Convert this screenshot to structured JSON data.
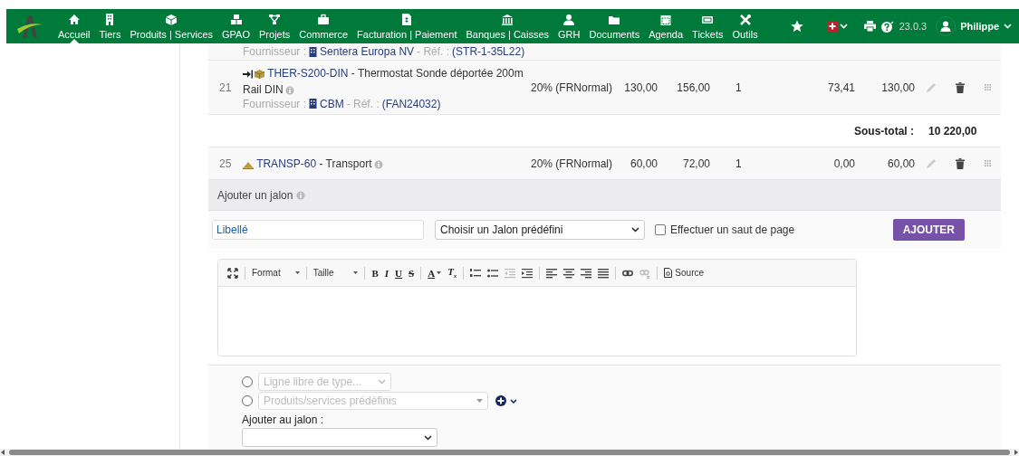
{
  "nav": {
    "items": [
      {
        "label": "Accueil",
        "selected": true
      },
      {
        "label": "Tiers",
        "selected": false
      },
      {
        "label": "Produits | Services",
        "selected": false
      },
      {
        "label": "GPAO",
        "selected": false
      },
      {
        "label": "Projets",
        "selected": false
      },
      {
        "label": "Commerce",
        "selected": false
      },
      {
        "label": "Facturation | Paiement",
        "selected": false
      },
      {
        "label": "Banques | Caisses",
        "selected": false
      },
      {
        "label": "GRH",
        "selected": false
      },
      {
        "label": "Documents",
        "selected": false
      },
      {
        "label": "Agenda",
        "selected": false
      },
      {
        "label": "Tickets",
        "selected": false
      },
      {
        "label": "Outils",
        "selected": false
      }
    ],
    "version": "23.0.3",
    "user": "Philippe"
  },
  "lines": [
    {
      "kind": "supplier_only",
      "supplier_label": "Fournisseur :",
      "supplier": "Sentera Europa NV",
      "ref_label": "- Réf. :",
      "ref": "(STR-1-35L22)"
    },
    {
      "kind": "product",
      "num": "21",
      "code": "THER-S200-DIN",
      "label": "- Thermostat Sonde déportée 200m Rail DIN",
      "vat": "20% (FRNormal)",
      "pu_ht": "130,00",
      "pu_ttc": "156,00",
      "qty": "1",
      "discount": "73,41",
      "total": "130,00",
      "supplier_label": "Fournisseur :",
      "supplier": "CBM",
      "ref_label": "- Réf. :",
      "ref": "(FAN24032)"
    },
    {
      "kind": "subtotal",
      "label": "Sous-total :",
      "total": "10 220,00"
    },
    {
      "kind": "service",
      "num": "25",
      "code": "TRANSP-60",
      "label": "- Transport",
      "vat": "20% (FRNormal)",
      "pu_ht": "60,00",
      "pu_ttc": "72,00",
      "qty": "1",
      "discount": "0,00",
      "total": "60,00"
    }
  ],
  "jalon": {
    "title": "Ajouter un jalon",
    "label_field": {
      "placeholder": "Libellé"
    },
    "predefined": "Choisir un Jalon prédéfini",
    "page_break": {
      "label": "Effectuer un saut de page",
      "checked": false
    },
    "button": "AJOUTER"
  },
  "editor": {
    "format": "Format",
    "size": "Taille",
    "bold": "B",
    "italic": "I",
    "underline": "U",
    "strike": "S",
    "text_color": "A",
    "clear_format": "T",
    "clear_sub": "x",
    "source": "Source"
  },
  "add_line": {
    "free_line": {
      "placeholder": "Ligne libre de type...",
      "selected": false
    },
    "predefined": {
      "placeholder": "Produits/services prédéfinis",
      "selected": false
    },
    "milestone_label": "Ajouter au jalon :"
  }
}
